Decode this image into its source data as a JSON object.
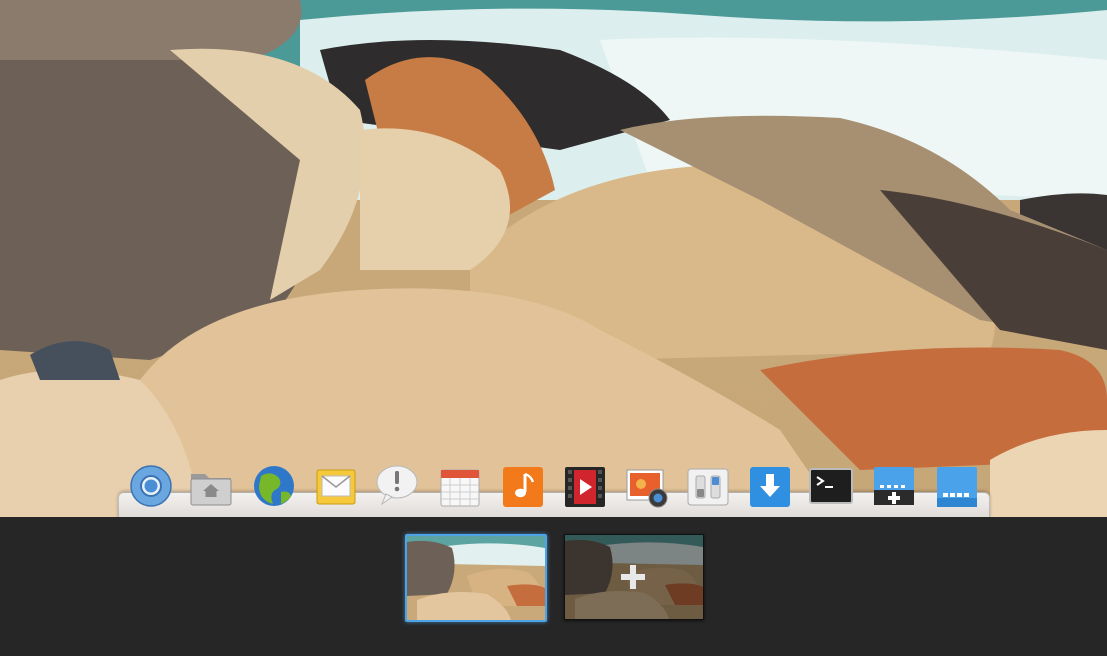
{
  "desktop": {
    "wallpaper": "rocky-beach-wallpaper"
  },
  "dock": {
    "items": [
      {
        "name": "chromium",
        "icon": "chromium-icon"
      },
      {
        "name": "files",
        "icon": "home-folder-icon"
      },
      {
        "name": "web-browser",
        "icon": "globe-icon"
      },
      {
        "name": "mail",
        "icon": "envelope-icon"
      },
      {
        "name": "notifications",
        "icon": "speech-bubble-exclamation-icon"
      },
      {
        "name": "calendar",
        "icon": "calendar-icon"
      },
      {
        "name": "music",
        "icon": "music-note-icon"
      },
      {
        "name": "videos",
        "icon": "film-play-icon"
      },
      {
        "name": "photos",
        "icon": "photo-camera-icon"
      },
      {
        "name": "settings",
        "icon": "toggle-switches-icon"
      },
      {
        "name": "software-center",
        "icon": "download-arrow-icon"
      },
      {
        "name": "terminal",
        "icon": "terminal-icon"
      },
      {
        "name": "add-workspace-panel",
        "icon": "workspace-add-icon"
      },
      {
        "name": "workspace-panel",
        "icon": "workspace-icon"
      }
    ]
  },
  "workspaces": {
    "items": [
      {
        "name": "workspace-1",
        "state": "current"
      },
      {
        "name": "new-workspace",
        "state": "add"
      }
    ],
    "accent": "#4da3e6"
  }
}
